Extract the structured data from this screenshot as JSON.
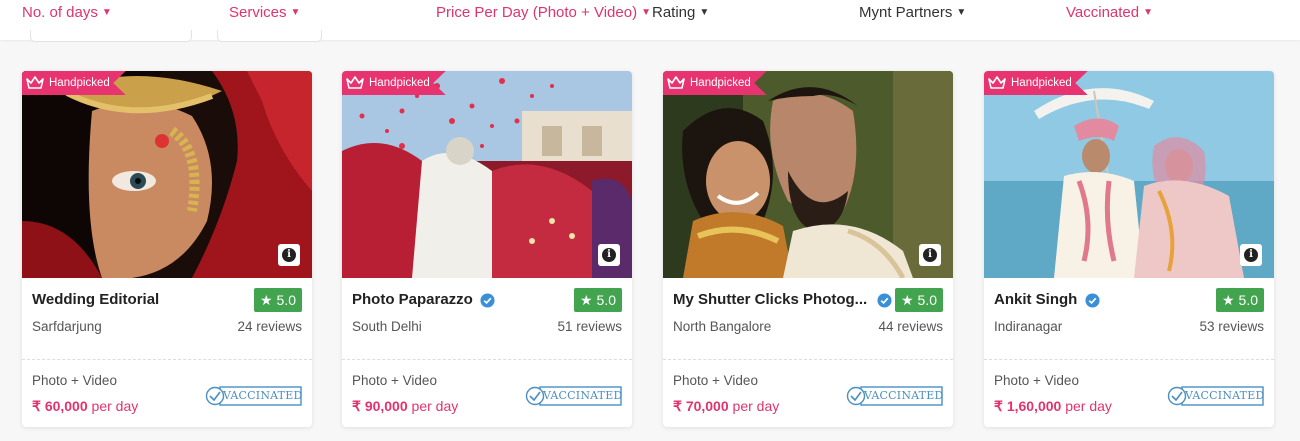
{
  "filters": [
    {
      "label": "No. of days",
      "active": true
    },
    {
      "label": "Services",
      "active": true
    },
    {
      "label": "Price Per Day (Photo + Video)",
      "active": true
    },
    {
      "label": "Rating",
      "active": false
    },
    {
      "label": "Mynt Partners",
      "active": false
    },
    {
      "label": "Vaccinated",
      "active": true
    }
  ],
  "colors": {
    "accent": "#e0336f",
    "rating_green": "#42a44e",
    "verified_blue": "#3a8fd6",
    "vaccinated_blue": "#4a8fc2"
  },
  "cards": [
    {
      "badge": "Handpicked",
      "name": "Wedding Editorial",
      "verified": false,
      "rating": "5.0",
      "location": "Sarfdarjung",
      "reviews": "24 reviews",
      "service": "Photo + Video",
      "currency": "₹",
      "price": "60,000",
      "price_unit": "per day",
      "vaccinated_label": "VACCINATED"
    },
    {
      "badge": "Handpicked",
      "name": "Photo Paparazzo",
      "verified": true,
      "rating": "5.0",
      "location": "South Delhi",
      "reviews": "51 reviews",
      "service": "Photo + Video",
      "currency": "₹",
      "price": "90,000",
      "price_unit": "per day",
      "vaccinated_label": "VACCINATED"
    },
    {
      "badge": "Handpicked",
      "name": "My Shutter Clicks Photog...",
      "verified": true,
      "rating": "5.0",
      "location": "North Bangalore",
      "reviews": "44 reviews",
      "service": "Photo + Video",
      "currency": "₹",
      "price": "70,000",
      "price_unit": "per day",
      "vaccinated_label": "VACCINATED"
    },
    {
      "badge": "Handpicked",
      "name": "Ankit Singh",
      "verified": true,
      "rating": "5.0",
      "location": "Indiranagar",
      "reviews": "53 reviews",
      "service": "Photo + Video",
      "currency": "₹",
      "price": "1,60,000",
      "price_unit": "per day",
      "vaccinated_label": "VACCINATED"
    }
  ]
}
